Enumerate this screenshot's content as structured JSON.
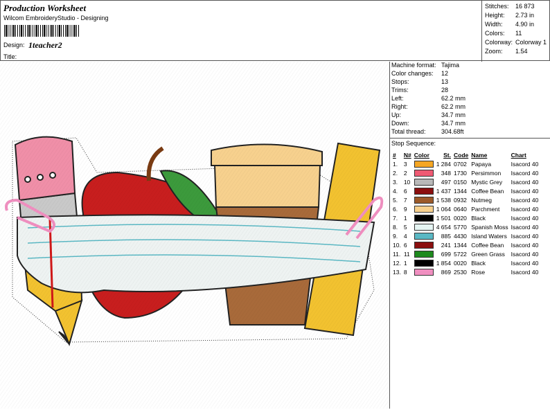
{
  "header": {
    "title": "Production Worksheet",
    "subtitle": "Wilcom EmbroideryStudio - Designing",
    "design_label": "Design:",
    "design_value": "1teacher2",
    "title_label": "Title:"
  },
  "summary": [
    {
      "label": "Stitches:",
      "value": "16 873"
    },
    {
      "label": "Height:",
      "value": "2.73 in"
    },
    {
      "label": "Width:",
      "value": "4.90 in"
    },
    {
      "label": "Colors:",
      "value": "11"
    },
    {
      "label": "Colorway:",
      "value": "Colorway 1"
    },
    {
      "label": "Zoom:",
      "value": "1.54"
    }
  ],
  "machine": [
    {
      "label": "Machine format:",
      "value": "Tajima"
    },
    {
      "label": "Color changes:",
      "value": "12"
    },
    {
      "label": "Stops:",
      "value": "13"
    },
    {
      "label": "Trims:",
      "value": "28"
    },
    {
      "label": "Left:",
      "value": "62.2 mm"
    },
    {
      "label": "Right:",
      "value": "62.2 mm"
    },
    {
      "label": "Up:",
      "value": "34.7 mm"
    },
    {
      "label": "Down:",
      "value": "34.7 mm"
    },
    {
      "label": "Total thread:",
      "value": "304.68ft"
    }
  ],
  "stop_sequence_label": "Stop Sequence:",
  "columns": [
    "#",
    "N#",
    "Color",
    "St.",
    "Code",
    "Name",
    "Chart"
  ],
  "stops": [
    {
      "n": "1.",
      "needle": "3",
      "color": "#f5a623",
      "st": "1 284",
      "code": "0702",
      "name": "Papaya",
      "chart": "Isacord 40"
    },
    {
      "n": "2.",
      "needle": "2",
      "color": "#ef5a73",
      "st": "348",
      "code": "1730",
      "name": "Persimmon",
      "chart": "Isacord 40"
    },
    {
      "n": "3.",
      "needle": "10",
      "color": "#b9b9b9",
      "st": "497",
      "code": "0150",
      "name": "Mystic Grey",
      "chart": "Isacord 40"
    },
    {
      "n": "4.",
      "needle": "6",
      "color": "#8b0f0f",
      "st": "1 437",
      "code": "1344",
      "name": "Coffee Bean",
      "chart": "Isacord 40"
    },
    {
      "n": "5.",
      "needle": "7",
      "color": "#9c5a2a",
      "st": "1 538",
      "code": "0932",
      "name": "Nutmeg",
      "chart": "Isacord 40"
    },
    {
      "n": "6.",
      "needle": "9",
      "color": "#f7d18e",
      "st": "1 064",
      "code": "0640",
      "name": "Parchment",
      "chart": "Isacord 40"
    },
    {
      "n": "7.",
      "needle": "1",
      "color": "#000000",
      "st": "1 501",
      "code": "0020",
      "name": "Black",
      "chart": "Isacord 40"
    },
    {
      "n": "8.",
      "needle": "5",
      "color": "#e6f5f3",
      "st": "4 654",
      "code": "5770",
      "name": "Spanish Moss",
      "chart": "Isacord 40"
    },
    {
      "n": "9.",
      "needle": "4",
      "color": "#5ab8c4",
      "st": "885",
      "code": "4430",
      "name": "Island Waters",
      "chart": "Isacord 40"
    },
    {
      "n": "10.",
      "needle": "6",
      "color": "#8b0f0f",
      "st": "241",
      "code": "1344",
      "name": "Coffee Bean",
      "chart": "Isacord 40"
    },
    {
      "n": "11.",
      "needle": "11",
      "color": "#1e8a1e",
      "st": "699",
      "code": "5722",
      "name": "Green Grass",
      "chart": "Isacord 40"
    },
    {
      "n": "12.",
      "needle": "1",
      "color": "#000000",
      "st": "1 854",
      "code": "0020",
      "name": "Black",
      "chart": "Isacord 40"
    },
    {
      "n": "13.",
      "needle": "8",
      "color": "#f08fc0",
      "st": "869",
      "code": "2530",
      "name": "Rose",
      "chart": "Isacord 40"
    }
  ],
  "colors": {
    "pencil_body": "#f2c230",
    "eraser": "#f08fa8",
    "apple": "#c81e1e",
    "leaf": "#3c9a3c",
    "cup": "#a86a3a",
    "lid": "#f7d18e",
    "ruler": "#f2c230",
    "paper": "#eef3f2",
    "paper_lines": "#5ab8c4",
    "clip": "#f08fc0"
  }
}
